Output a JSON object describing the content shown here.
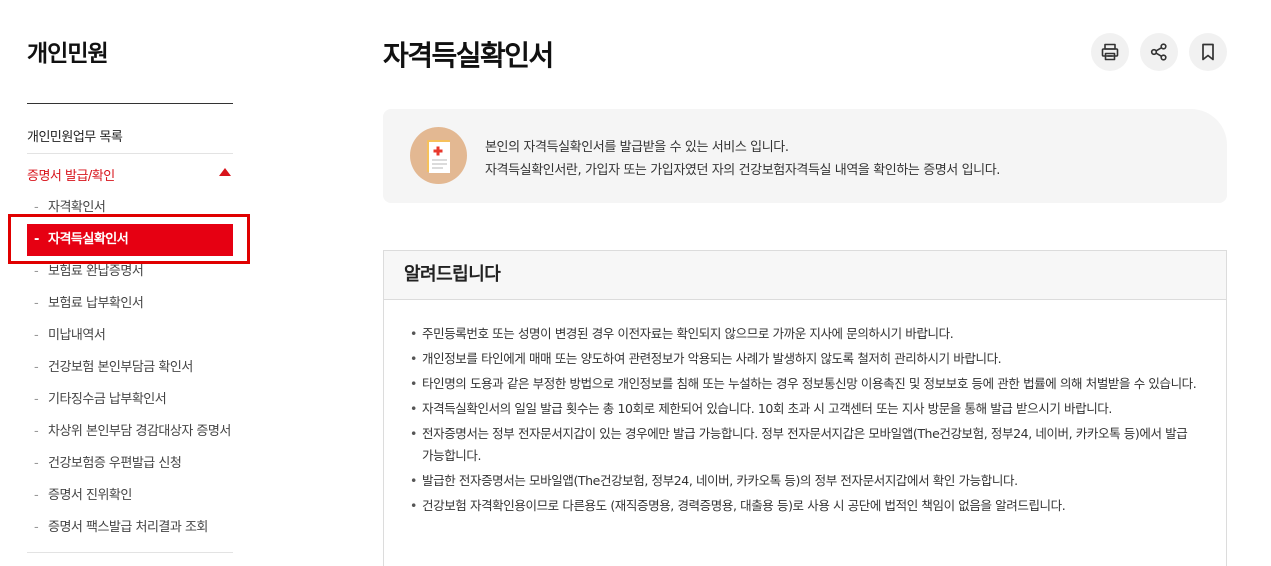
{
  "sidebar": {
    "title": "개인민원",
    "list_link": "개인민원업무 목록",
    "category": "증명서 발급/확인",
    "items": [
      {
        "label": "자격확인서",
        "active": false
      },
      {
        "label": "자격득실확인서",
        "active": true
      },
      {
        "label": "보험료 완납증명서",
        "active": false
      },
      {
        "label": "보험료 납부확인서",
        "active": false
      },
      {
        "label": "미납내역서",
        "active": false
      },
      {
        "label": "건강보험 본인부담금 확인서",
        "active": false
      },
      {
        "label": "기타징수금 납부확인서",
        "active": false
      },
      {
        "label": "차상위 본인부담 경감대상자 증명서",
        "active": false
      },
      {
        "label": "건강보험증 우편발급 신청",
        "active": false
      },
      {
        "label": "증명서 진위확인",
        "active": false
      },
      {
        "label": "증명서 팩스발급 처리결과 조회",
        "active": false
      }
    ]
  },
  "main": {
    "title": "자격득실확인서",
    "tools": [
      "print-icon",
      "share-icon",
      "bookmark-icon"
    ],
    "intro": {
      "line1": "본인의 자격득실확인서를 발급받을 수 있는 서비스 입니다.",
      "line2": "자격득실확인서란, 가입자 또는 가입자였던 자의 건강보험자격득실 내역을 확인하는 증명서 입니다."
    },
    "notice": {
      "heading": "알려드립니다",
      "items": [
        "주민등록번호 또는 성명이 변경된 경우 이전자료는 확인되지 않으므로 가까운 지사에 문의하시기 바랍니다.",
        "개인정보를 타인에게 매매 또는 양도하여 관련정보가 악용되는 사례가 발생하지 않도록 철저히 관리하시기 바랍니다.",
        "타인명의 도용과 같은 부정한 방법으로 개인정보를 침해 또는 누설하는 경우 정보통신망 이용촉진 및 정보보호 등에 관한 법률에 의해 처벌받을 수 있습니다.",
        "자격득실확인서의 일일 발급 횟수는 총 10회로 제한되어 있습니다. 10회 초과 시 고객센터 또는 지사 방문을 통해 발급 받으시기 바랍니다.",
        "전자증명서는 정부 전자문서지갑이 있는 경우에만 발급 가능합니다. 정부 전자문서지갑은 모바일앱(The건강보험, 정부24, 네이버, 카카오톡 등)에서 발급 가능합니다.",
        "발급한 전자증명서는 모바일앱(The건강보험, 정부24, 네이버, 카카오톡 등)의 정부 전자문서지갑에서 확인 가능합니다.",
        "건강보험 자격확인용이므로 다른용도 (재직증명용, 경력증명용, 대출용 등)로 사용 시 공단에 법적인 책임이 없음을 알려드립니다."
      ]
    }
  },
  "colors": {
    "accent": "#e60012",
    "category": "#d8141c",
    "highlight_outline": "#e00000"
  }
}
